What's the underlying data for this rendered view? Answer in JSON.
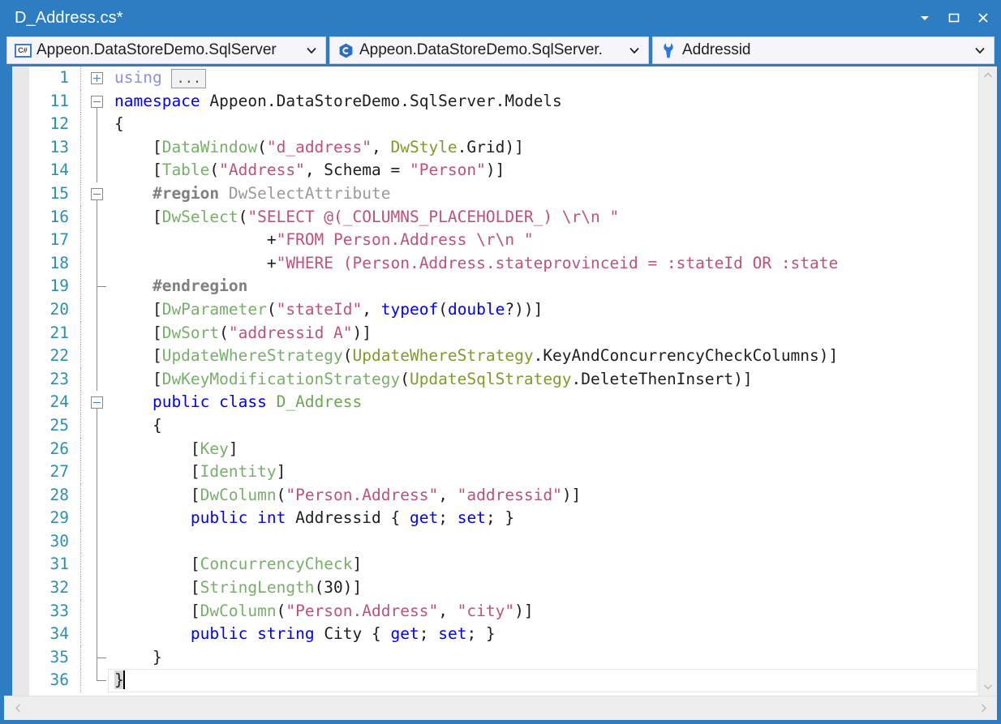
{
  "window": {
    "title": "D_Address.cs*",
    "controls": [
      {
        "name": "window-menu-chevron",
        "glyph": "▾"
      },
      {
        "name": "maximize",
        "glyph": "□"
      },
      {
        "name": "close",
        "glyph": "✕"
      }
    ],
    "accent_color": "#2e7cc2"
  },
  "navbar": {
    "project": {
      "label": "Appeon.DataStoreDemo.SqlServer",
      "icon": "csharp-file-icon",
      "icon_text": "C#",
      "arrow": "⌄"
    },
    "type": {
      "label": "Appeon.DataStoreDemo.SqlServer.",
      "icon": "class-icon",
      "icon_text": "C",
      "arrow": "⌄"
    },
    "member": {
      "label": "Addressid",
      "icon": "wrench-property-icon",
      "arrow": "⌄"
    }
  },
  "editor": {
    "language": "csharp",
    "colors": {
      "keyword": "#0000ff",
      "type": "#2b91af",
      "attribute": "#78b06a",
      "enum_type": "#7f9c2b",
      "string": "#c0507e",
      "preprocessor": "#808080",
      "line_number": "#2b91af",
      "background": "#ffffff",
      "text": "#1e1e1e"
    },
    "lines": [
      {
        "num": "1",
        "fold": "plus",
        "tokens": [
          {
            "t": "using ",
            "c": "kwc"
          },
          {
            "t": "…",
            "c": "ellipsis"
          }
        ]
      },
      {
        "num": "11",
        "fold": "minus",
        "tokens": [
          {
            "t": "namespace",
            "c": "kw"
          },
          {
            "t": " Appeon.DataStoreDemo.SqlServer.Models",
            "c": "plain"
          }
        ]
      },
      {
        "num": "12",
        "fold": "line",
        "tokens": [
          {
            "t": "{",
            "c": "punc"
          }
        ]
      },
      {
        "num": "13",
        "fold": "line",
        "tokens": [
          {
            "t": "    [",
            "c": "punc"
          },
          {
            "t": "DataWindow",
            "c": "attr"
          },
          {
            "t": "(",
            "c": "punc"
          },
          {
            "t": "\"d_address\"",
            "c": "str"
          },
          {
            "t": ", ",
            "c": "punc"
          },
          {
            "t": "DwStyle",
            "c": "enumt"
          },
          {
            "t": ".Grid",
            "c": "plain"
          },
          {
            "t": ")]",
            "c": "punc"
          }
        ]
      },
      {
        "num": "14",
        "fold": "line",
        "tokens": [
          {
            "t": "    [",
            "c": "punc"
          },
          {
            "t": "Table",
            "c": "attr"
          },
          {
            "t": "(",
            "c": "punc"
          },
          {
            "t": "\"Address\"",
            "c": "str"
          },
          {
            "t": ", Schema = ",
            "c": "punc"
          },
          {
            "t": "\"Person\"",
            "c": "str"
          },
          {
            "t": ")]",
            "c": "punc"
          }
        ]
      },
      {
        "num": "15",
        "fold": "minus2",
        "tokens": [
          {
            "t": "    #region",
            "c": "preproc"
          },
          {
            "t": " DwSelectAttribute",
            "c": "regionname"
          }
        ]
      },
      {
        "num": "16",
        "fold": "line",
        "tokens": [
          {
            "t": "    [",
            "c": "punc"
          },
          {
            "t": "DwSelect",
            "c": "attr"
          },
          {
            "t": "(",
            "c": "punc"
          },
          {
            "t": "\"SELECT @(_COLUMNS_PLACEHOLDER_) \\r\\n \"",
            "c": "str"
          }
        ]
      },
      {
        "num": "17",
        "fold": "line",
        "tokens": [
          {
            "t": "                +",
            "c": "punc"
          },
          {
            "t": "\"FROM Person.Address \\r\\n \"",
            "c": "str"
          }
        ]
      },
      {
        "num": "18",
        "fold": "line",
        "tokens": [
          {
            "t": "                +",
            "c": "punc"
          },
          {
            "t": "\"WHERE (Person.Address.stateprovinceid = :stateId OR :state",
            "c": "str"
          }
        ]
      },
      {
        "num": "19",
        "fold": "endtick",
        "tokens": [
          {
            "t": "    #endregion",
            "c": "preproc"
          }
        ]
      },
      {
        "num": "20",
        "fold": "line",
        "tokens": [
          {
            "t": "    [",
            "c": "punc"
          },
          {
            "t": "DwParameter",
            "c": "attr"
          },
          {
            "t": "(",
            "c": "punc"
          },
          {
            "t": "\"stateId\"",
            "c": "str"
          },
          {
            "t": ", ",
            "c": "punc"
          },
          {
            "t": "typeof",
            "c": "kw"
          },
          {
            "t": "(",
            "c": "punc"
          },
          {
            "t": "double",
            "c": "kw"
          },
          {
            "t": "?))]",
            "c": "punc"
          }
        ]
      },
      {
        "num": "21",
        "fold": "line",
        "tokens": [
          {
            "t": "    [",
            "c": "punc"
          },
          {
            "t": "DwSort",
            "c": "attr"
          },
          {
            "t": "(",
            "c": "punc"
          },
          {
            "t": "\"addressid A\"",
            "c": "str"
          },
          {
            "t": ")]",
            "c": "punc"
          }
        ]
      },
      {
        "num": "22",
        "fold": "line",
        "tokens": [
          {
            "t": "    [",
            "c": "punc"
          },
          {
            "t": "UpdateWhereStrategy",
            "c": "attr"
          },
          {
            "t": "(",
            "c": "punc"
          },
          {
            "t": "UpdateWhereStrategy",
            "c": "enumt"
          },
          {
            "t": ".KeyAndConcurrencyCheckColumns",
            "c": "plain"
          },
          {
            "t": ")]",
            "c": "punc"
          }
        ]
      },
      {
        "num": "23",
        "fold": "line",
        "tokens": [
          {
            "t": "    [",
            "c": "punc"
          },
          {
            "t": "DwKeyModificationStrategy",
            "c": "attr"
          },
          {
            "t": "(",
            "c": "punc"
          },
          {
            "t": "UpdateSqlStrategy",
            "c": "enumt"
          },
          {
            "t": ".DeleteThenInsert",
            "c": "plain"
          },
          {
            "t": ")]",
            "c": "punc"
          }
        ]
      },
      {
        "num": "24",
        "fold": "minus2",
        "tokens": [
          {
            "t": "    ",
            "c": "punc"
          },
          {
            "t": "public",
            "c": "kw"
          },
          {
            "t": " ",
            "c": "punc"
          },
          {
            "t": "class",
            "c": "kw"
          },
          {
            "t": " ",
            "c": "punc"
          },
          {
            "t": "D_Address",
            "c": "cls"
          }
        ]
      },
      {
        "num": "25",
        "fold": "line",
        "tokens": [
          {
            "t": "    {",
            "c": "punc"
          }
        ]
      },
      {
        "num": "26",
        "fold": "line",
        "tokens": [
          {
            "t": "        [",
            "c": "punc"
          },
          {
            "t": "Key",
            "c": "attr"
          },
          {
            "t": "]",
            "c": "punc"
          }
        ]
      },
      {
        "num": "27",
        "fold": "line",
        "tokens": [
          {
            "t": "        [",
            "c": "punc"
          },
          {
            "t": "Identity",
            "c": "attr"
          },
          {
            "t": "]",
            "c": "punc"
          }
        ]
      },
      {
        "num": "28",
        "fold": "line",
        "tokens": [
          {
            "t": "        [",
            "c": "punc"
          },
          {
            "t": "DwColumn",
            "c": "attr"
          },
          {
            "t": "(",
            "c": "punc"
          },
          {
            "t": "\"Person.Address\"",
            "c": "str"
          },
          {
            "t": ", ",
            "c": "punc"
          },
          {
            "t": "\"addressid\"",
            "c": "str"
          },
          {
            "t": ")]",
            "c": "punc"
          }
        ]
      },
      {
        "num": "29",
        "fold": "line",
        "tokens": [
          {
            "t": "        ",
            "c": "punc"
          },
          {
            "t": "public",
            "c": "kw"
          },
          {
            "t": " ",
            "c": "punc"
          },
          {
            "t": "int",
            "c": "kw"
          },
          {
            "t": " Addressid { ",
            "c": "plain"
          },
          {
            "t": "get",
            "c": "kw"
          },
          {
            "t": "; ",
            "c": "plain"
          },
          {
            "t": "set",
            "c": "kw"
          },
          {
            "t": "; }",
            "c": "plain"
          }
        ]
      },
      {
        "num": "30",
        "fold": "line",
        "tokens": []
      },
      {
        "num": "31",
        "fold": "line",
        "tokens": [
          {
            "t": "        [",
            "c": "punc"
          },
          {
            "t": "ConcurrencyCheck",
            "c": "attr"
          },
          {
            "t": "]",
            "c": "punc"
          }
        ]
      },
      {
        "num": "32",
        "fold": "line",
        "tokens": [
          {
            "t": "        [",
            "c": "punc"
          },
          {
            "t": "StringLength",
            "c": "attr"
          },
          {
            "t": "(30)]",
            "c": "punc"
          }
        ]
      },
      {
        "num": "33",
        "fold": "line",
        "tokens": [
          {
            "t": "        [",
            "c": "punc"
          },
          {
            "t": "DwColumn",
            "c": "attr"
          },
          {
            "t": "(",
            "c": "punc"
          },
          {
            "t": "\"Person.Address\"",
            "c": "str"
          },
          {
            "t": ", ",
            "c": "punc"
          },
          {
            "t": "\"city\"",
            "c": "str"
          },
          {
            "t": ")]",
            "c": "punc"
          }
        ]
      },
      {
        "num": "34",
        "fold": "line",
        "tokens": [
          {
            "t": "        ",
            "c": "punc"
          },
          {
            "t": "public",
            "c": "kw"
          },
          {
            "t": " ",
            "c": "punc"
          },
          {
            "t": "string",
            "c": "kw"
          },
          {
            "t": " City { ",
            "c": "plain"
          },
          {
            "t": "get",
            "c": "kw"
          },
          {
            "t": "; ",
            "c": "plain"
          },
          {
            "t": "set",
            "c": "kw"
          },
          {
            "t": "; }",
            "c": "plain"
          }
        ]
      },
      {
        "num": "35",
        "fold": "endtick",
        "tokens": [
          {
            "t": "    }",
            "c": "punc"
          }
        ]
      },
      {
        "num": "36",
        "fold": "endcorner",
        "current": true,
        "tokens": [
          {
            "t": "}",
            "c": "punc brace-hl"
          },
          {
            "t": "",
            "c": "caret"
          }
        ]
      }
    ]
  },
  "scrollbars": {
    "vertical": {
      "up": "⌃",
      "down": "⌄"
    },
    "horizontal": {
      "left": "‹",
      "right": "›"
    }
  }
}
